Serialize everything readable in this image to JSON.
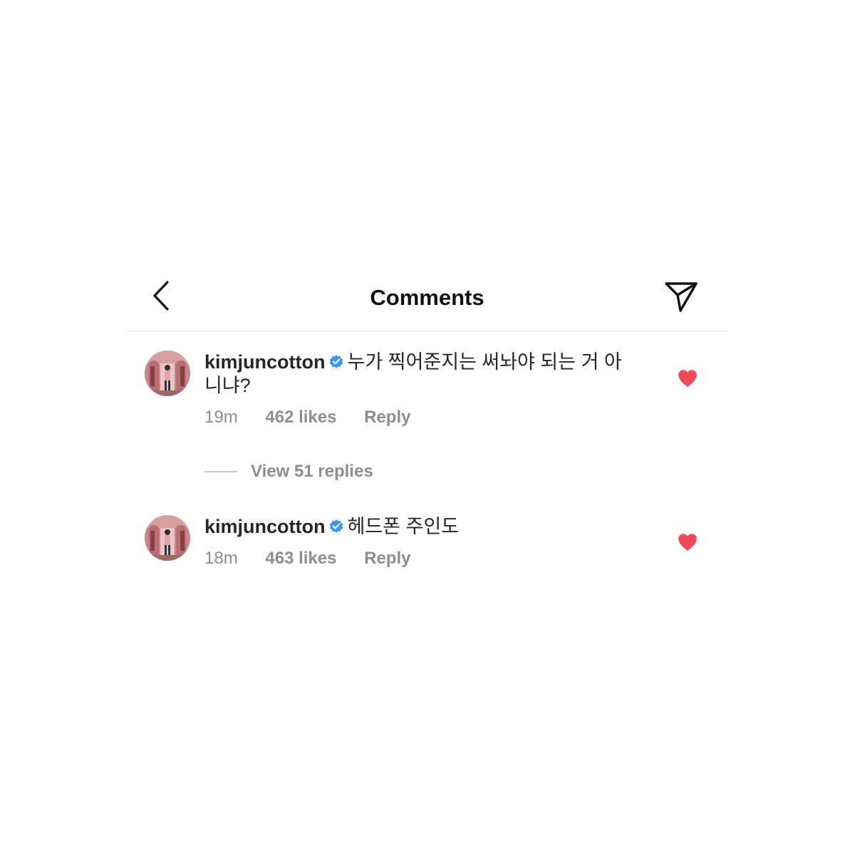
{
  "header": {
    "title": "Comments",
    "back_icon": "chevron-left-icon",
    "share_icon": "paper-plane-icon"
  },
  "comments": [
    {
      "username": "kimjuncotton",
      "verified": true,
      "text": "누가 찍어준지는 써놔야 되는 거 아니냐?",
      "time": "19m",
      "likes": "462 likes",
      "reply": "Reply",
      "liked": true
    },
    {
      "username": "kimjuncotton",
      "verified": true,
      "text": "헤드폰 주인도",
      "time": "18m",
      "likes": "463 likes",
      "reply": "Reply",
      "liked": true
    }
  ],
  "view_replies": {
    "label": "View 51 replies"
  },
  "colors": {
    "heart": "#ed4956",
    "verified": "#3897f0",
    "meta_text": "#8e8e8e",
    "divider": "#e4e4e4"
  }
}
